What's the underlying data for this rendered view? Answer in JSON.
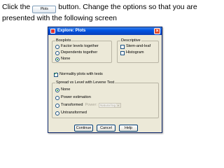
{
  "instruction": {
    "part1": "Click the",
    "button_label": "Plots",
    "part2": "button. Change the options so that you are presented with the following screen"
  },
  "dialog": {
    "title": "Explore: Plots",
    "boxplots": {
      "legend": "Boxplots",
      "options": [
        "Factor levels together",
        "Dependents together",
        "None"
      ],
      "selected": "None"
    },
    "descriptive": {
      "legend": "Descriptive",
      "options": [
        "Stem-and-leaf",
        "Histogram"
      ],
      "checked": []
    },
    "normality": {
      "label": "Normality plots with tests",
      "checked": true
    },
    "spread": {
      "legend": "Spread vs Level with Levene Test",
      "options": [
        "None",
        "Power estimation",
        "Transformed",
        "Untransformed"
      ],
      "selected": "None",
      "power_label": "Power:",
      "power_value": "Natural log"
    },
    "buttons": {
      "continue": "Continue",
      "cancel": "Cancel",
      "help": "Help"
    }
  },
  "colors": {
    "titlebar": "#0054e3",
    "dialog_bg": "#ece9d8",
    "radio_dot": "#21a121"
  }
}
